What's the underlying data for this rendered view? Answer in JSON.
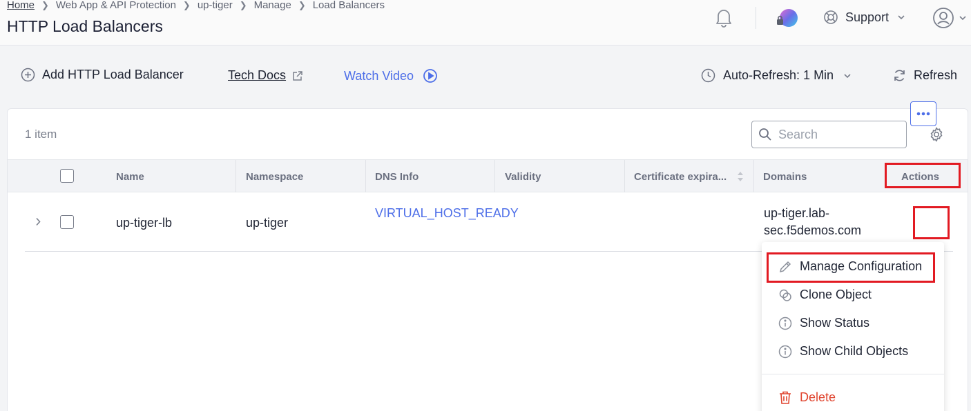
{
  "breadcrumb": {
    "items": [
      "Home",
      "Web App & API Protection",
      "up-tiger",
      "Manage",
      "Load Balancers"
    ]
  },
  "page": {
    "title": "HTTP Load Balancers"
  },
  "header": {
    "support_label": "Support",
    "icons": [
      "bell-icon",
      "org-avatar",
      "support-icon",
      "user-icon"
    ]
  },
  "toolbar": {
    "add_label": "Add HTTP Load Balancer",
    "tech_docs_label": "Tech Docs",
    "watch_video_label": "Watch Video",
    "auto_refresh_label": "Auto-Refresh: 1 Min",
    "refresh_label": "Refresh"
  },
  "table": {
    "item_count": "1 item",
    "search_placeholder": "Search",
    "columns": [
      "Name",
      "Namespace",
      "DNS Info",
      "Validity",
      "Certificate expira...",
      "Domains",
      "Actions"
    ],
    "rows": [
      {
        "name": "up-tiger-lb",
        "namespace": "up-tiger",
        "dns_info": "VIRTUAL_HOST_READY",
        "validity": "",
        "certificate_expiration": "",
        "domains": "up-tiger.lab-sec.f5demos.com"
      }
    ]
  },
  "actions_menu": {
    "items": [
      "Manage Configuration",
      "Clone Object",
      "Show Status",
      "Show Child Objects"
    ],
    "delete_label": "Delete"
  },
  "colors": {
    "accent": "#4d6ee8",
    "danger": "#e0442e",
    "highlight": "#e21a22",
    "text": "#1f2433"
  }
}
